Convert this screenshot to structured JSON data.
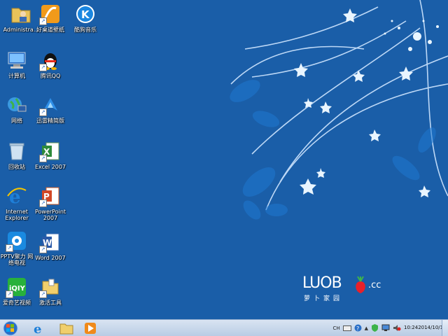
{
  "desktop": {
    "icons": [
      {
        "label": "Administra..."
      },
      {
        "label": "好桌道壁纸"
      },
      {
        "label": "酷狗音乐"
      },
      {
        "label": "计算机"
      },
      {
        "label": "腾讯QQ"
      },
      {
        "label": "网络"
      },
      {
        "label": "迅雷精简版"
      },
      {
        "label": "回收站"
      },
      {
        "label": "Excel 2007"
      },
      {
        "label": "Internet\nExplorer"
      },
      {
        "label": "PowerPoint\n2007"
      },
      {
        "label": "PPTV聚力 网\n络电视"
      },
      {
        "label": "Word 2007"
      },
      {
        "label": "爱奇艺视频"
      },
      {
        "label": "激活工具"
      }
    ]
  },
  "wallpaper": {
    "logo_main": "LUOB",
    "logo_cc": ".cc",
    "logo_sub": "萝卜家园"
  },
  "taskbar": {
    "tray": {
      "lang": "CH",
      "time": "10:24",
      "date": "2014/10/18"
    }
  },
  "colors": {
    "desktop_bg": "#1a5ea8",
    "taskbar_bg": "#c9d9ee"
  }
}
